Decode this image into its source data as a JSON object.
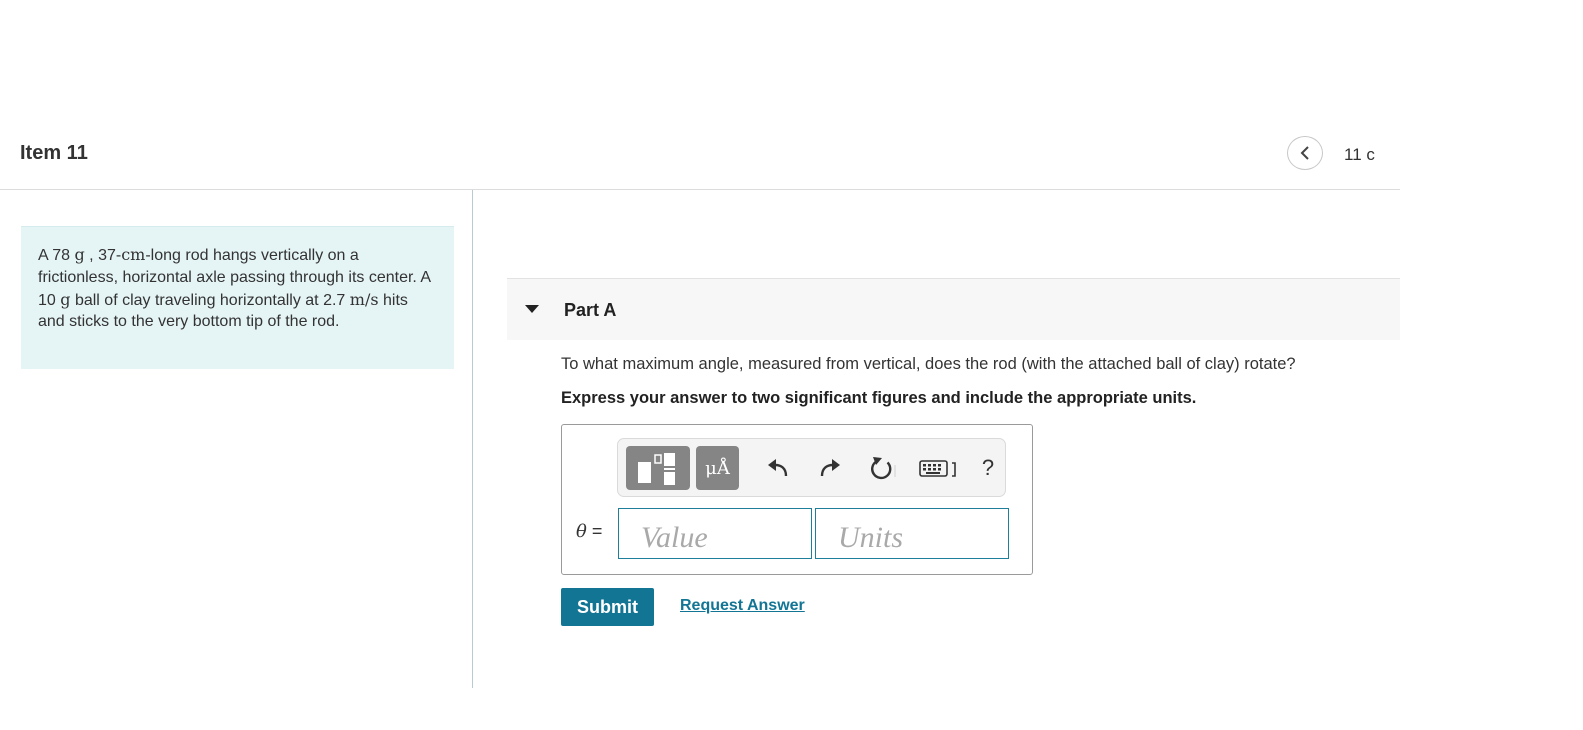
{
  "header": {
    "item_title": "Item 11",
    "counter_text": "11 c"
  },
  "problem": {
    "t1": "A 78 ",
    "m1": "g",
    "t2": " , 37-",
    "m2": "cm",
    "t3": "-long rod hangs vertically on a frictionless, horizontal axle passing through its center. A 10 ",
    "m3": "g",
    "t4": " ball of clay traveling horizontally at 2.7 ",
    "m4": "m/s",
    "t5": " hits and sticks to the very bottom tip of the rod."
  },
  "part": {
    "title": "Part A",
    "question": "To what maximum angle, measured from vertical, does the rod (with the attached ball of clay) rotate?",
    "instruction": "Express your answer to two significant figures and include the appropriate units."
  },
  "toolbar": {
    "units_label": "μÅ",
    "help_label": "?"
  },
  "answer": {
    "variable": "θ",
    "equals": " =",
    "value_placeholder": "Value",
    "units_placeholder": "Units"
  },
  "actions": {
    "submit_label": "Submit",
    "request_label": "Request Answer"
  },
  "colors": {
    "accent": "#137594",
    "problem_bg": "#e5f4f5",
    "toolbar_button": "#858585"
  },
  "icons": [
    "chevron-left-icon",
    "caret-down-icon",
    "templates-icon",
    "undo-icon",
    "redo-icon",
    "reset-icon",
    "keyboard-icon"
  ]
}
